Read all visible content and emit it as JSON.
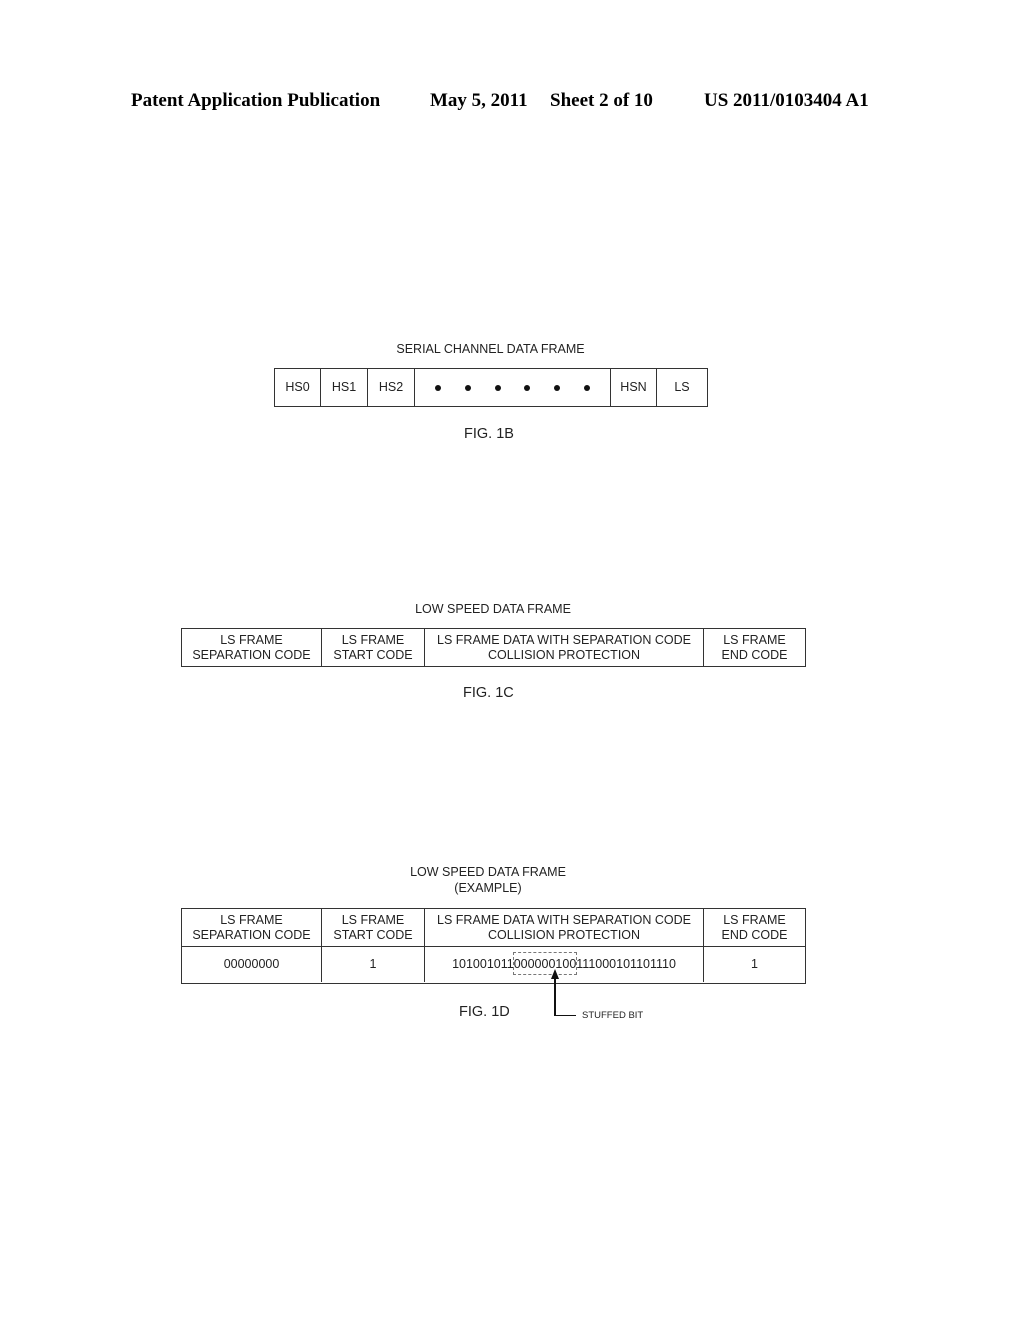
{
  "header": {
    "publication_type": "Patent Application Publication",
    "date": "May 5, 2011",
    "sheet": "Sheet 2 of 10",
    "patent_number": "US 2011/0103404 A1"
  },
  "fig_1b": {
    "title": "SERIAL CHANNEL DATA FRAME",
    "cells": [
      "HS0",
      "HS1",
      "HS2",
      "ellipsis-dots",
      "HSN",
      "LS"
    ],
    "ellipsis_dot_count": 6,
    "label": "FIG. 1B"
  },
  "fig_1c": {
    "title": "LOW SPEED DATA  FRAME",
    "columns": [
      {
        "line1": "LS FRAME",
        "line2": "SEPARATION CODE"
      },
      {
        "line1": "LS FRAME",
        "line2": "START CODE"
      },
      {
        "line1": "LS FRAME DATA WITH SEPARATION CODE",
        "line2": "COLLISION PROTECTION"
      },
      {
        "line1": "LS FRAME",
        "line2": "END CODE"
      }
    ],
    "label": "FIG. 1C"
  },
  "fig_1d": {
    "title_line1": "LOW SPEED DATA  FRAME",
    "title_line2": "(EXAMPLE)",
    "columns": [
      {
        "line1": "LS FRAME",
        "line2": "SEPARATION CODE"
      },
      {
        "line1": "LS FRAME",
        "line2": "START CODE"
      },
      {
        "line1": "LS FRAME DATA WITH SEPARATION CODE",
        "line2": "COLLISION PROTECTION"
      },
      {
        "line1": "LS FRAME",
        "line2": "END CODE"
      }
    ],
    "values": {
      "separation_code": "00000000",
      "start_code": "1",
      "data_prefix": "101001011",
      "data_highlighted": "000000100",
      "data_suffix": "111000101101110",
      "end_code": "1"
    },
    "annotation": "STUFFED BIT",
    "label": "FIG. 1D"
  }
}
